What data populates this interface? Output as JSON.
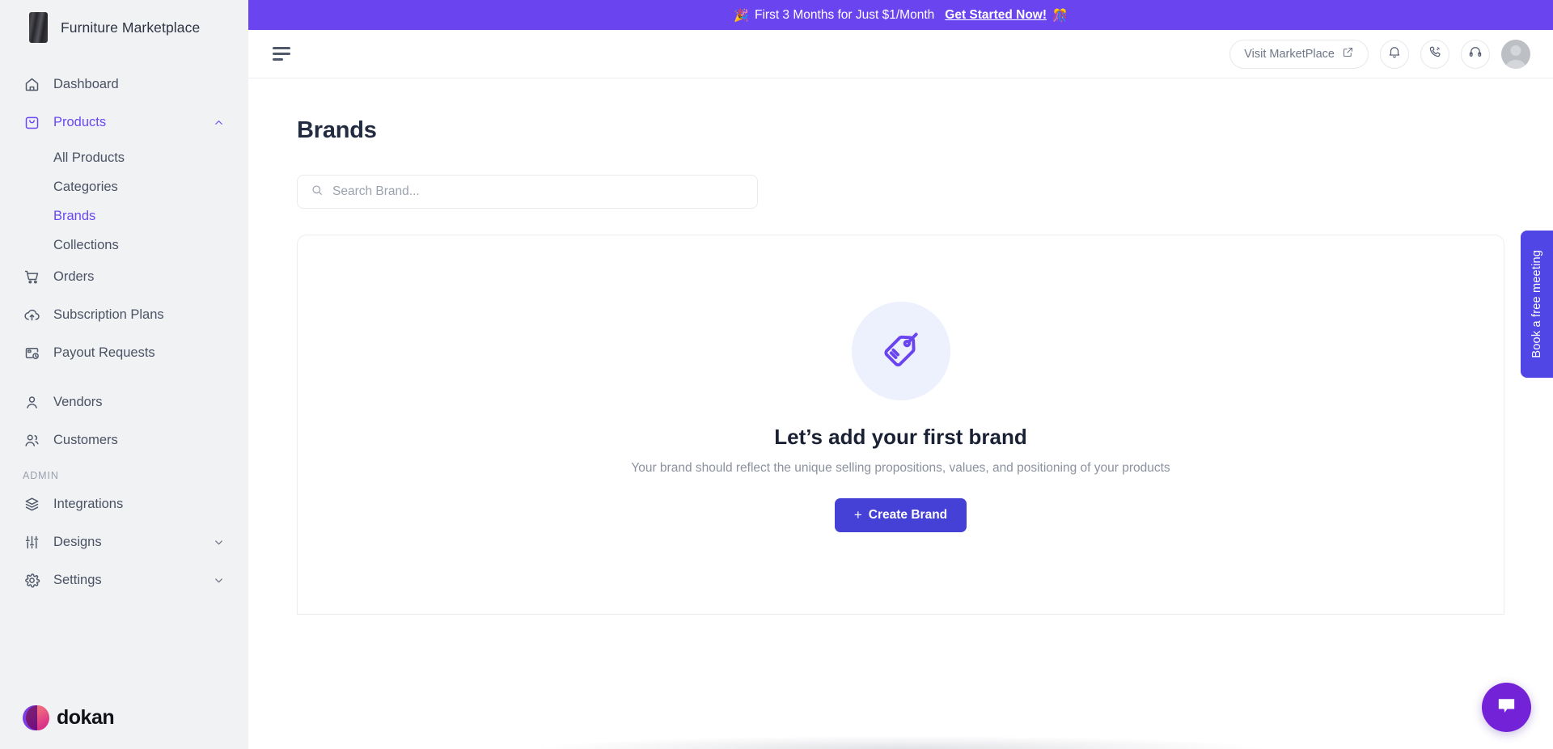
{
  "sidebar": {
    "brand_title": "Furniture Marketplace",
    "brand_logo_icon": "furniture-logo",
    "items": [
      {
        "label": "Dashboard",
        "icon": "home-icon",
        "active": false,
        "chevron": null
      },
      {
        "label": "Products",
        "icon": "bag-icon",
        "active": true,
        "chevron": "chevron-up-icon"
      },
      {
        "label": "Orders",
        "icon": "cart-icon",
        "active": false,
        "chevron": null
      },
      {
        "label": "Subscription Plans",
        "icon": "cloud-upload-icon",
        "active": false,
        "chevron": null
      },
      {
        "label": "Payout Requests",
        "icon": "payout-icon",
        "active": false,
        "chevron": null
      },
      {
        "label": "Vendors",
        "icon": "user-icon",
        "active": false,
        "chevron": null
      },
      {
        "label": "Customers",
        "icon": "users-icon",
        "active": false,
        "chevron": null
      }
    ],
    "products_subitems": [
      {
        "label": "All Products",
        "active": false
      },
      {
        "label": "Categories",
        "active": false
      },
      {
        "label": "Brands",
        "active": true
      },
      {
        "label": "Collections",
        "active": false
      }
    ],
    "section_label": "ADMIN",
    "admin_items": [
      {
        "label": "Integrations",
        "icon": "layers-icon",
        "chevron": null
      },
      {
        "label": "Designs",
        "icon": "sliders-icon",
        "chevron": "chevron-down-icon"
      },
      {
        "label": "Settings",
        "icon": "gear-icon",
        "chevron": "chevron-down-icon"
      }
    ],
    "footer_logo_text": "dokan",
    "footer_logo_icon": "dokan-logo"
  },
  "promo": {
    "emoji_left": "🎉",
    "text": "First 3 Months for Just $1/Month",
    "link": "Get Started Now!",
    "emoji_right": "🎊",
    "bg_color": "#6a44ef"
  },
  "topbar": {
    "menu_icon": "hamburger-icon",
    "visit_label": "Visit MarketPlace",
    "external_icon": "external-link-icon",
    "bell_icon": "bell-icon",
    "phone_icon": "phone-call-icon",
    "headset_icon": "headset-icon",
    "avatar_icon": "user-avatar"
  },
  "page": {
    "title": "Brands",
    "search_placeholder": "Search Brand...",
    "search_value": "",
    "search_icon": "search-icon"
  },
  "empty_state": {
    "icon": "tag-icon",
    "icon_color": "#6a44ef",
    "circle_color": "#edf0fd",
    "title": "Let’s add your first brand",
    "description": "Your brand should reflect the unique selling propositions, values, and positioning of your products",
    "button_plus": "+",
    "button_label": "Create Brand",
    "button_color": "#4540d6"
  },
  "floating": {
    "meeting_tab_label": "Book a free meeting",
    "meeting_tab_color": "#4f46e5",
    "chat_icon": "chat-bubble-icon",
    "chat_color": "#7322d8"
  }
}
